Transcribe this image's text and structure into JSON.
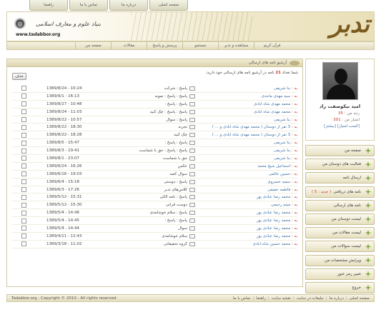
{
  "top_links": [
    "صفحه اصلی",
    "درباره ما",
    "تماس با ما",
    "راهنما"
  ],
  "header": {
    "logo": "تدبر",
    "tagline": "بنیاد علوم و معارف اسلامی",
    "url": "www.tadabbor.org"
  },
  "nav": [
    "قرآن کریم",
    "مشاهده و تدبر",
    "جستجو",
    "پرسش و پاسخ",
    "مقالات",
    "صفحه من"
  ],
  "profile": {
    "name": "امید نیکوصفت راد",
    "rank_label": "رتبه من :",
    "rank_value": "35",
    "points_label": "امتیاز من :",
    "points_value": "301",
    "points_link": "[کسب امتیاز] [بیشتر]"
  },
  "menu": [
    {
      "label": "صفحه من",
      "badge": ""
    },
    {
      "label": "فعالیت های دوستان من",
      "badge": ""
    },
    {
      "label": "ارسال نامه",
      "badge": ""
    },
    {
      "label": "نامه های دریافتی",
      "badge": "( جدید : 5 )"
    },
    {
      "label": "نامه های ارسالی",
      "badge": ""
    },
    {
      "label": "لیست دوستان من",
      "badge": ""
    },
    {
      "label": "لیست مقالات من",
      "badge": ""
    },
    {
      "label": "لیست سوالات من",
      "badge": ""
    },
    {
      "label": "ویرایش مشخصات من",
      "badge": ""
    },
    {
      "label": "تغییر رمز عبور",
      "badge": ""
    },
    {
      "label": "خروج",
      "badge": ""
    }
  ],
  "main": {
    "title": "آرشیو نامه های ارسالی",
    "summary_pre": "شما تعداد",
    "summary_count": "21",
    "summary_post": "نامه در آرشیو نامه های ارسالی خود دارید.",
    "delete_label": "حذف"
  },
  "recipient_label": "به :",
  "rows": [
    {
      "to": "بنا شریفی",
      "subject": "پاسخ : شرکت",
      "date": "1389/8/24 - 10:24"
    },
    {
      "to": "سید مهدی ماجدی",
      "subject": "پاسخ : پاسخ : نمونه",
      "date": "1389/9/1 - 16:13"
    },
    {
      "to": "محمد مهدی شاه آبادی",
      "subject": "پاسخ : پاسخ :",
      "date": "1389/8/27 - 10:48"
    },
    {
      "to": "محمد مهدی شاه آبادی",
      "subject": "پاسخ : پاسخ : چک کنید",
      "date": "1389/8/24 - 11:03"
    },
    {
      "to": "بنا شریفی",
      "subject": "پاسخ : سوال",
      "date": "1389/8/22 - 10:57"
    },
    {
      "to": "3 نفر از دوستان ( محمد مهدی شاه آبادی و ... )",
      "subject": "تجربه",
      "date": "1389/8/22 - 18:30"
    },
    {
      "to": "3 نفر از دوستان ( محمد مهدی شاه آبادی و ... )",
      "subject": "چک کنید",
      "date": "1389/8/22 - 18:28"
    },
    {
      "to": "بنا شریفی",
      "subject": "پاسخ : پاسخ :",
      "date": "1389/8/5 - 15:47"
    },
    {
      "to": "بنا شریفی",
      "subject": "پاسخ : پاسخ : حق با شماست",
      "date": "1389/8/3 - 19:41"
    },
    {
      "to": "بنا شریفی",
      "subject": "حق با شماست",
      "date": "1389/8/1 - 23:07"
    },
    {
      "to": "اسماعیل شیخ محمد",
      "subject": "عکس",
      "date": "1389/6/24 - 16:26"
    },
    {
      "to": "حسین عالمی",
      "subject": "سوال کعبه",
      "date": "1389/6/16 - 19:03"
    },
    {
      "to": "سعید خسروی",
      "subject": "پاسخ : دوستی",
      "date": "1389/6/4 - 15:18"
    },
    {
      "to": "فاطمه حقیقی",
      "subject": "کلاس‌های تدبر",
      "date": "1389/6/3 - 17:26"
    },
    {
      "to": "محمد رضا عبادی پور",
      "subject": "پاسخ : نامه الکی",
      "date": "1389/5/12 - 15:31"
    },
    {
      "to": "میثم رحیمی",
      "subject": "دوست قرآنی",
      "date": "1389/5/12 - 15:30"
    },
    {
      "to": "محمد رضا عبادی پور",
      "subject": "پاسخ : سلام خوشامدی",
      "date": "1389/5/4 - 14:46"
    },
    {
      "to": "محمد رضا عبادی پور",
      "subject": "پاسخ : پاسخ :",
      "date": "1389/5/4 - 14:45"
    },
    {
      "to": "محمد رضا عبادی پور",
      "subject": "سوال",
      "date": "1389/5/4 - 14:44"
    },
    {
      "to": "محمد رضا عبادی پور",
      "subject": "سلام خوشامدی",
      "date": "1389/4/11 - 12:43"
    },
    {
      "to": "محمد حسین شاه آبادی",
      "subject": "گروه تحقیقاتی",
      "date": "1389/3/18 - 11:02"
    }
  ],
  "footer": {
    "copyright": "Tadabbor.org - Copyright © 2010 - All rights reserved",
    "links": [
      "صفحه اصلی",
      "درباره ما",
      "تبلیغات در سایت",
      "نقشه سایت",
      "راهنما",
      "تماس با ما"
    ]
  }
}
